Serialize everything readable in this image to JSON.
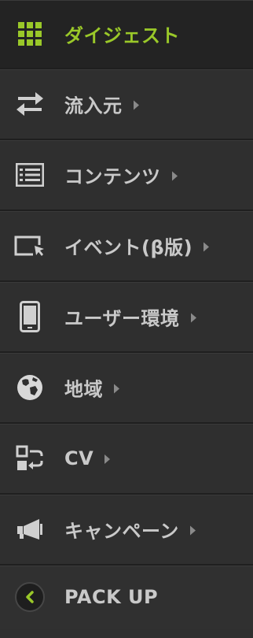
{
  "colors": {
    "accent": "#9ac829",
    "text": "#c9c9c9",
    "background": "#2f2f2f",
    "active_background": "#232323"
  },
  "nav": {
    "items": [
      {
        "label": "ダイジェスト",
        "icon": "grid-icon",
        "active": true
      },
      {
        "label": "流入元",
        "icon": "swap-arrows-icon"
      },
      {
        "label": "コンテンツ",
        "icon": "list-icon"
      },
      {
        "label": "イベント(β版)",
        "icon": "cursor-window-icon"
      },
      {
        "label": "ユーザー環境",
        "icon": "smartphone-icon"
      },
      {
        "label": "地域",
        "icon": "globe-icon"
      },
      {
        "label": "CV",
        "icon": "conversion-icon"
      },
      {
        "label": "キャンペーン",
        "icon": "megaphone-icon"
      }
    ]
  },
  "footer": {
    "pack_up_label": "PACK UP",
    "icon": "chevron-left-icon"
  }
}
